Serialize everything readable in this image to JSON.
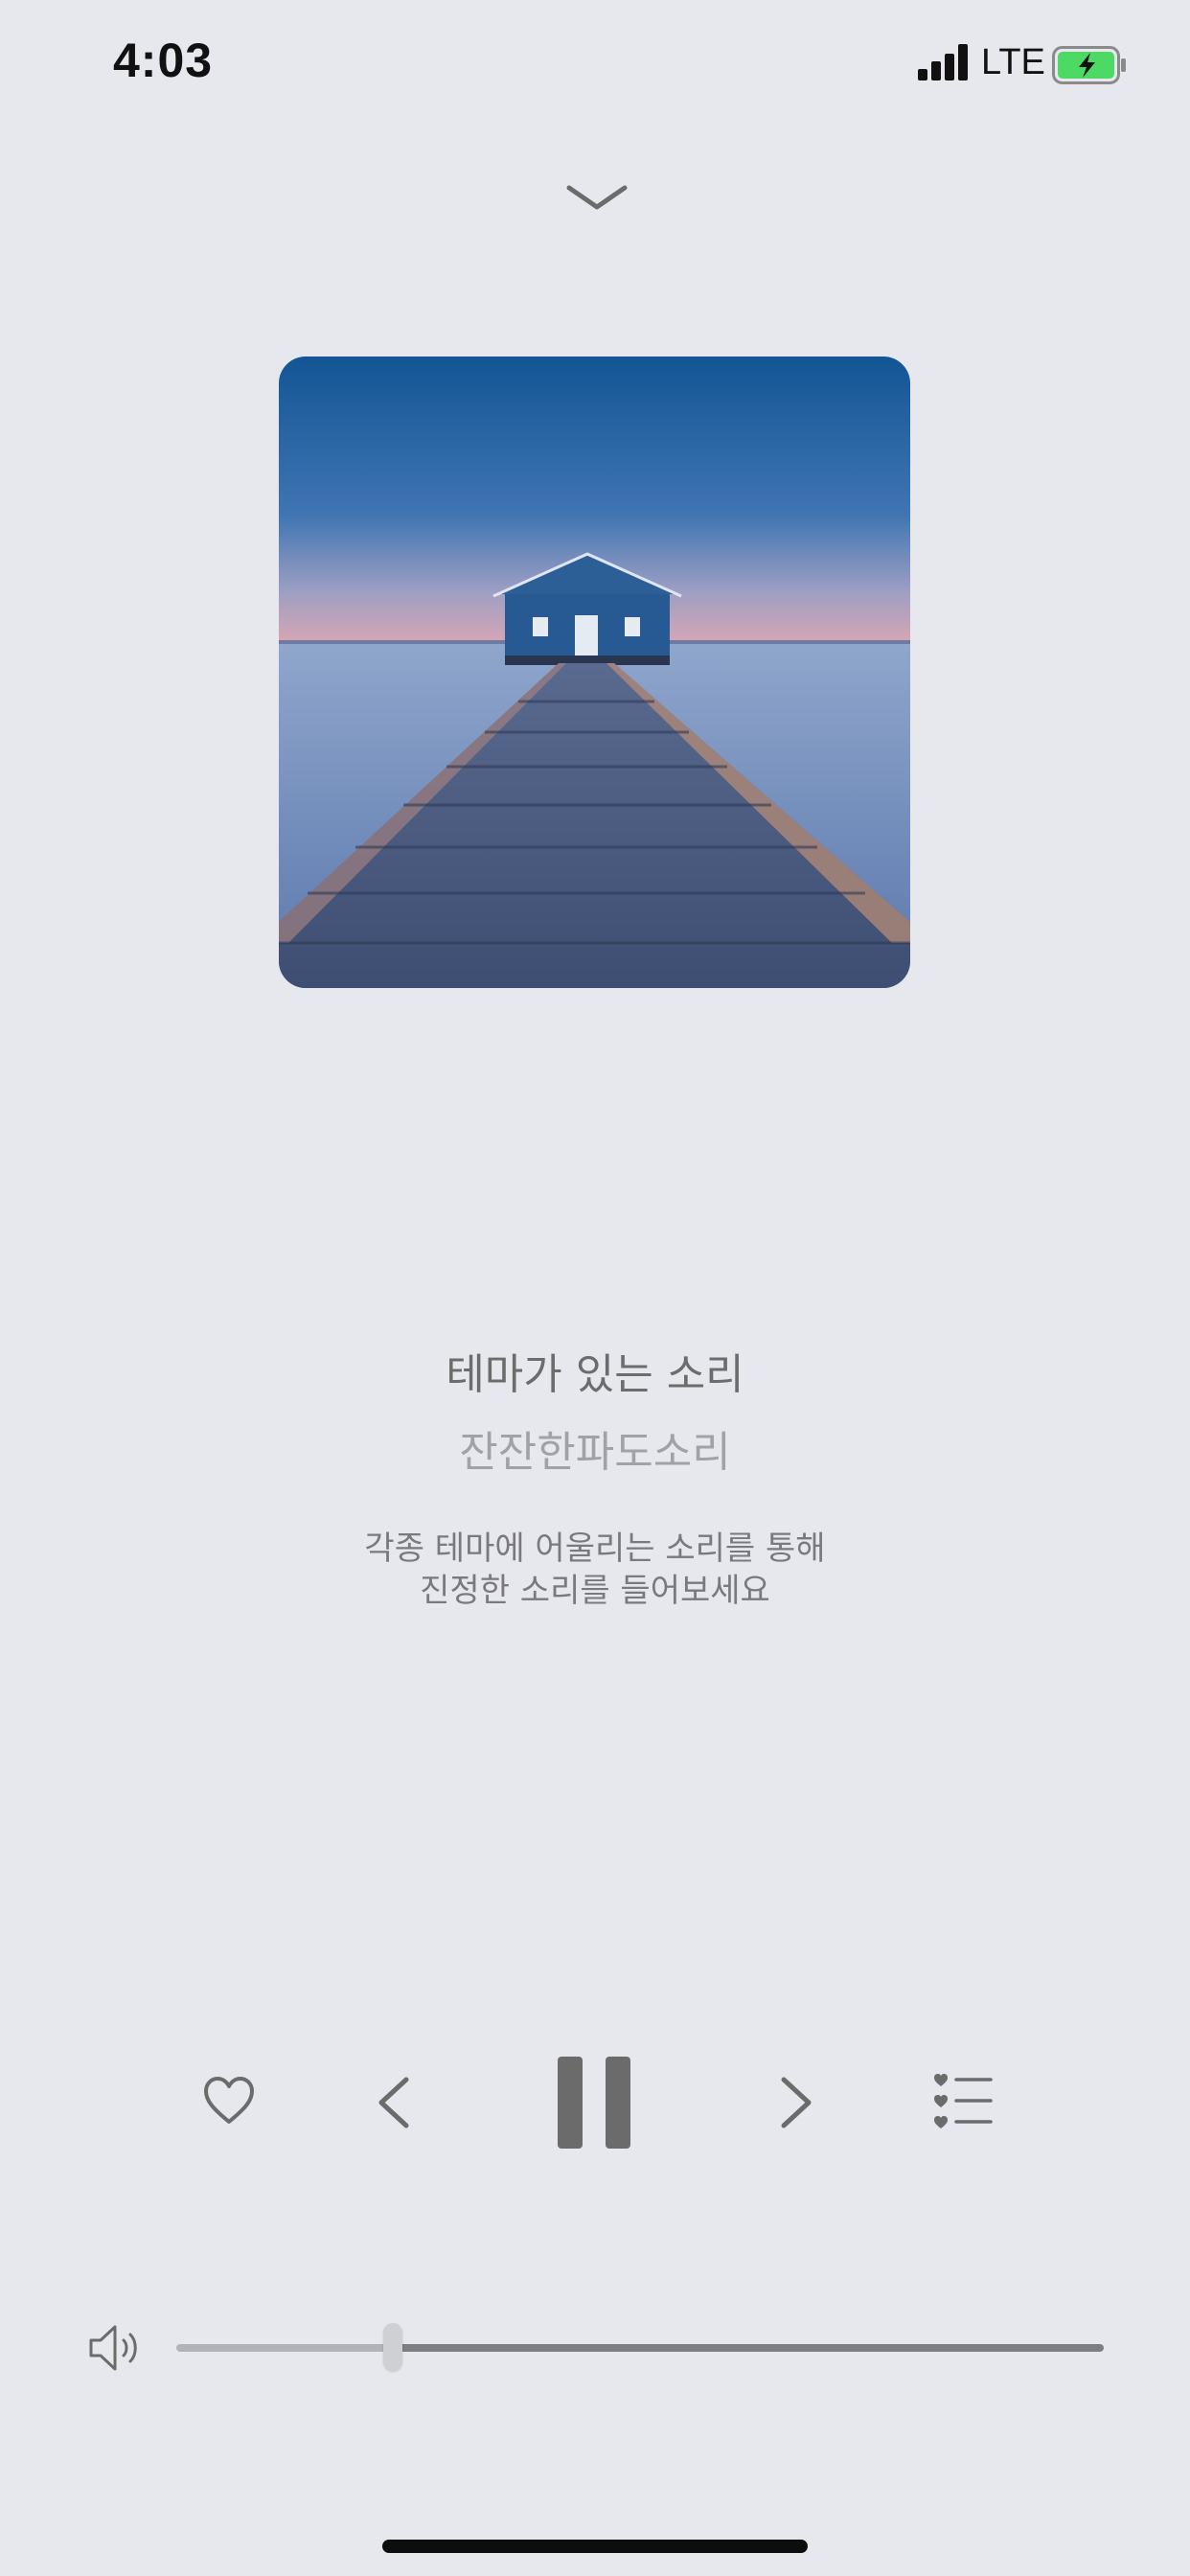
{
  "status_bar": {
    "time": "4:03",
    "network": "LTE",
    "icons": [
      "signal-icon",
      "battery-charging-icon"
    ]
  },
  "header": {
    "collapse_icon": "chevron-down-icon"
  },
  "track": {
    "title": "테마가 있는 소리",
    "subtitle": "잔잔한파도소리",
    "description_line1": "각종 테마에 어울리는 소리를 통해",
    "description_line2": "진정한 소리를 들어보세요"
  },
  "controls": {
    "icons": [
      "heart-icon",
      "previous-icon",
      "pause-icon",
      "next-icon",
      "playlist-icon"
    ]
  },
  "volume": {
    "icon": "speaker-icon",
    "level": 0.235
  },
  "colors": {
    "background": "#e7e8ee",
    "icon_gray": "#6b6b6b",
    "battery_green": "#4cd964"
  }
}
